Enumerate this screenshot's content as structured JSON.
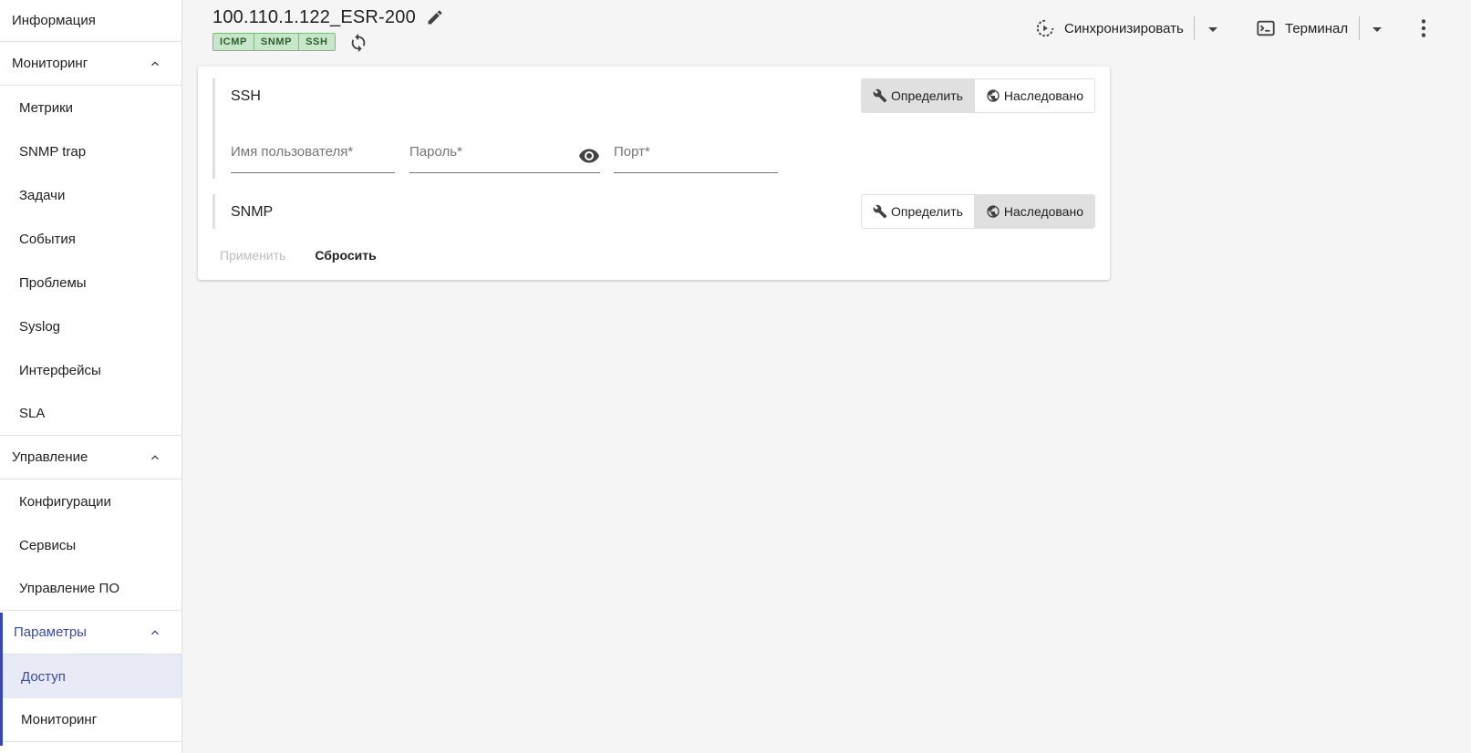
{
  "sidebar": {
    "info": "Информация",
    "monitoring": {
      "label": "Мониторинг",
      "items": [
        "Метрики",
        "SNMP trap",
        "Задачи",
        "События",
        "Проблемы",
        "Syslog",
        "Интерфейсы",
        "SLA"
      ]
    },
    "management": {
      "label": "Управление",
      "items": [
        "Конфигурации",
        "Сервисы",
        "Управление ПО"
      ]
    },
    "parameters": {
      "label": "Параметры",
      "items": [
        "Доступ",
        "Мониторинг"
      ]
    }
  },
  "header": {
    "title": "100.110.1.122_ESR-200",
    "chips": [
      "ICMP",
      "SNMP",
      "SSH"
    ],
    "sync_label": "Синхронизировать",
    "terminal_label": "Терминал"
  },
  "ssh": {
    "title": "SSH",
    "define_label": "Определить",
    "inherited_label": "Наследовано",
    "active_mode": "define",
    "username_placeholder": "Имя пользователя*",
    "password_placeholder": "Пароль*",
    "port_placeholder": "Порт*"
  },
  "snmp": {
    "title": "SNMP",
    "define_label": "Определить",
    "inherited_label": "Наследовано",
    "active_mode": "inherited"
  },
  "actions": {
    "apply_label": "Применить",
    "reset_label": "Сбросить"
  },
  "colors": {
    "accent": "#3949ab",
    "chip_bg": "#c8e6c9",
    "toggle_active": "#e0e0e0"
  }
}
